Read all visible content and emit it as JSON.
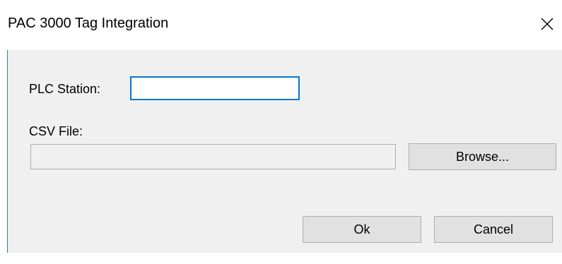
{
  "window": {
    "title": "PAC 3000 Tag Integration",
    "close_icon": "close-icon",
    "accent_border": "#1e7fd1"
  },
  "form": {
    "plc_station": {
      "label": "PLC Station:",
      "value": ""
    },
    "csv_file": {
      "label": "CSV File:",
      "value": "",
      "browse_label": "Browse..."
    }
  },
  "actions": {
    "ok_label": "Ok",
    "cancel_label": "Cancel"
  },
  "colors": {
    "client_background": "#f0f0f0",
    "focus_border": "#0078d7",
    "button_face": "#e1e1e1"
  }
}
